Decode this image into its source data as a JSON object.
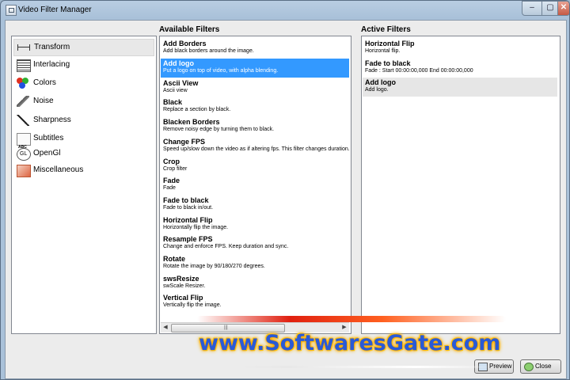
{
  "window": {
    "title": "Video Filter Manager",
    "controls": {
      "minimize": "‒",
      "maximize": "▢",
      "close": "✕"
    }
  },
  "categories": {
    "items": [
      {
        "label": "Transform",
        "icon": "transform-icon",
        "selected": true
      },
      {
        "label": "Interlacing",
        "icon": "interlacing-icon"
      },
      {
        "label": "Colors",
        "icon": "colors-icon"
      },
      {
        "label": "Noise",
        "icon": "noise-icon"
      },
      {
        "label": "Sharpness",
        "icon": "sharpness-icon"
      },
      {
        "label": "Subtitles",
        "icon": "subtitles-icon"
      },
      {
        "label": "OpenGl",
        "icon": "opengl-icon"
      },
      {
        "label": "Miscellaneous",
        "icon": "miscellaneous-icon"
      }
    ]
  },
  "available": {
    "heading": "Available Filters",
    "items": [
      {
        "name": "Add Borders",
        "desc": "Add black borders around the image."
      },
      {
        "name": "Add logo",
        "desc": "Put a logo on top of video, with alpha blending.",
        "selected": true
      },
      {
        "name": "Ascii View",
        "desc": "Ascii view"
      },
      {
        "name": "Black",
        "desc": "Replace a section by black."
      },
      {
        "name": "Blacken Borders",
        "desc": "Remove noisy edge by turning them to black."
      },
      {
        "name": "Change FPS",
        "desc": "Speed up/slow down the video as if altering fps. This filter changes duration."
      },
      {
        "name": "Crop",
        "desc": "Crop filter"
      },
      {
        "name": "Fade",
        "desc": "Fade"
      },
      {
        "name": "Fade to black",
        "desc": "Fade to black in/out."
      },
      {
        "name": "Horizontal Flip",
        "desc": "Horizontally flip the image."
      },
      {
        "name": "Resample FPS",
        "desc": "Change and enforce FPS. Keep duration and sync."
      },
      {
        "name": "Rotate",
        "desc": "Rotate the image by 90/180/270 degrees."
      },
      {
        "name": "swsResize",
        "desc": "swScale Resizer."
      },
      {
        "name": "Vertical Flip",
        "desc": "Vertically flip the image."
      }
    ],
    "scroll": {
      "left": "◀",
      "right": "▶",
      "grip": "|||"
    }
  },
  "active": {
    "heading": "Active Filters",
    "items": [
      {
        "name": "Horizontal Flip",
        "desc": "Horizontal flip."
      },
      {
        "name": "Fade to black",
        "desc": "Fade : Start 00:00:00,000 End 00:00:00,000"
      },
      {
        "name": "Add logo",
        "desc": "Add logo.",
        "selected": true
      }
    ]
  },
  "buttons": {
    "preview": "Preview",
    "close": "Close"
  },
  "watermark": {
    "text": "www.SoftwaresGate.com"
  },
  "colors": {
    "selection": "#3399ff",
    "watermark_text": "#2a5ad6",
    "watermark_glow": "#ffb000"
  }
}
